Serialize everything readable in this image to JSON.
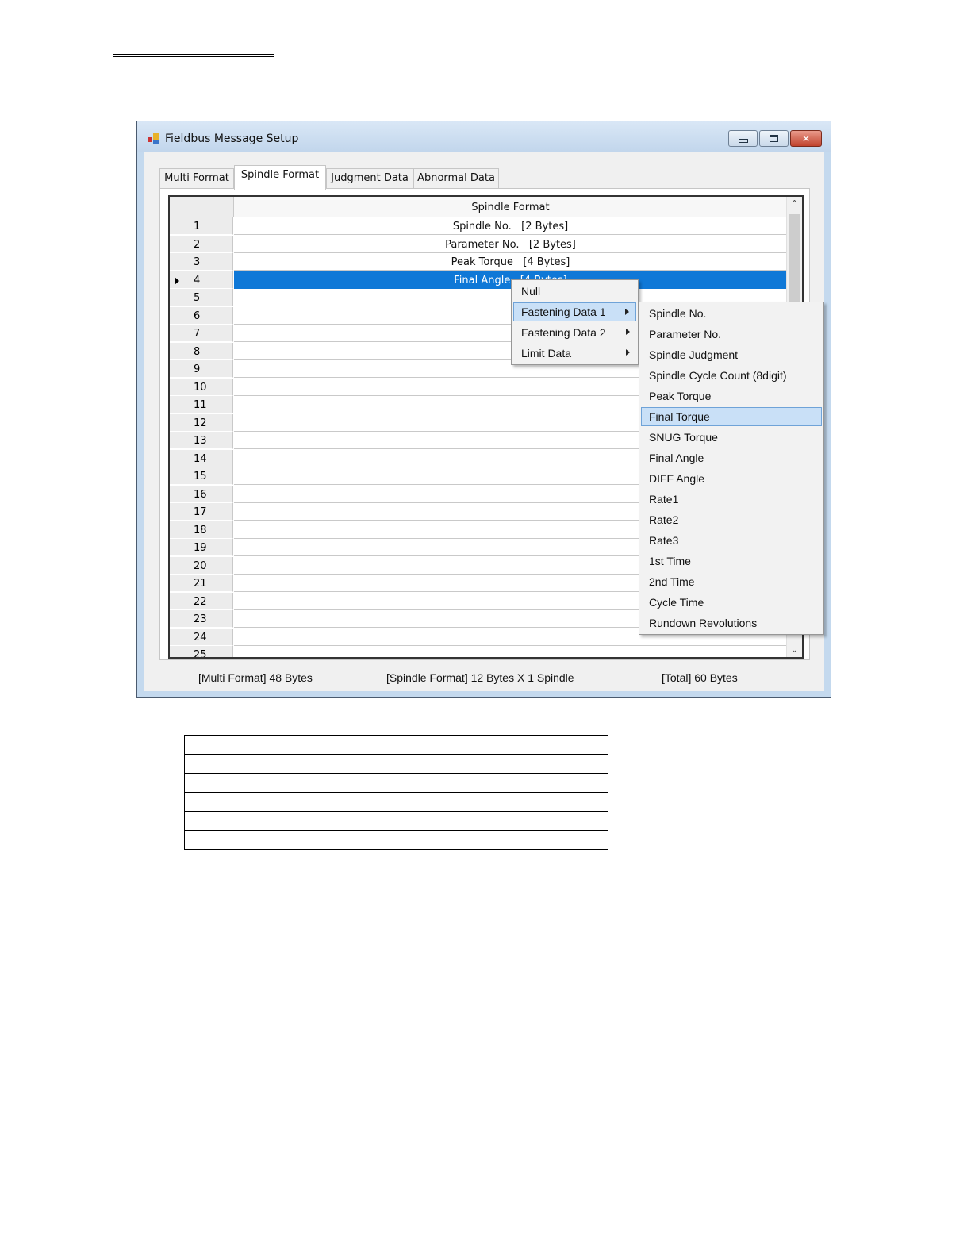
{
  "window": {
    "title": "Fieldbus Message Setup",
    "icons": {
      "app": "app-icon",
      "minimize": "minimize-icon",
      "maximize": "maximize-icon",
      "close": "close-icon"
    }
  },
  "tabs": [
    "Multi Format",
    "Spindle Format",
    "Judgment Data",
    "Abnormal Data"
  ],
  "active_tab": "Spindle Format",
  "grid": {
    "column_header": "Spindle Format",
    "rows": [
      {
        "num": "1",
        "value": "Spindle No.   [2 Bytes]"
      },
      {
        "num": "2",
        "value": "Parameter No.   [2 Bytes]"
      },
      {
        "num": "3",
        "value": "Peak Torque   [4 Bytes]"
      },
      {
        "num": "4",
        "value": "Final Angle   [4 Bytes]"
      },
      {
        "num": "5",
        "value": ""
      },
      {
        "num": "6",
        "value": ""
      },
      {
        "num": "7",
        "value": ""
      },
      {
        "num": "8",
        "value": ""
      },
      {
        "num": "9",
        "value": ""
      },
      {
        "num": "10",
        "value": ""
      },
      {
        "num": "11",
        "value": ""
      },
      {
        "num": "12",
        "value": ""
      },
      {
        "num": "13",
        "value": ""
      },
      {
        "num": "14",
        "value": ""
      },
      {
        "num": "15",
        "value": ""
      },
      {
        "num": "16",
        "value": ""
      },
      {
        "num": "17",
        "value": ""
      },
      {
        "num": "18",
        "value": ""
      },
      {
        "num": "19",
        "value": ""
      },
      {
        "num": "20",
        "value": ""
      },
      {
        "num": "21",
        "value": ""
      },
      {
        "num": "22",
        "value": ""
      },
      {
        "num": "23",
        "value": ""
      },
      {
        "num": "24",
        "value": ""
      },
      {
        "num": "25",
        "value": ""
      }
    ],
    "selected_row": "4"
  },
  "context_menu": {
    "items": [
      "Null",
      "Fastening Data 1",
      "Fastening Data 2",
      "Limit Data"
    ],
    "highlighted": "Fastening Data 1"
  },
  "submenu": {
    "items": [
      "Spindle No.",
      "Parameter No.",
      "Spindle Judgment",
      "Spindle Cycle Count (8digit)",
      "Peak Torque",
      "Final Torque",
      "SNUG  Torque",
      "Final Angle",
      "DIFF Angle",
      "Rate1",
      "Rate2",
      "Rate3",
      "1st Time",
      "2nd Time",
      "Cycle Time",
      "Rundown Revolutions"
    ],
    "highlighted": "Final Torque"
  },
  "status_bar": {
    "multi_format": "[Multi Format] 48 Bytes",
    "spindle_format": "[Spindle Format] 12 Bytes X 1 Spindle",
    "total": "[Total] 60 Bytes"
  },
  "colors": {
    "selection": "#0f78d7",
    "menu_highlight": "#c9e0f7",
    "close_button": "#c1432e"
  }
}
